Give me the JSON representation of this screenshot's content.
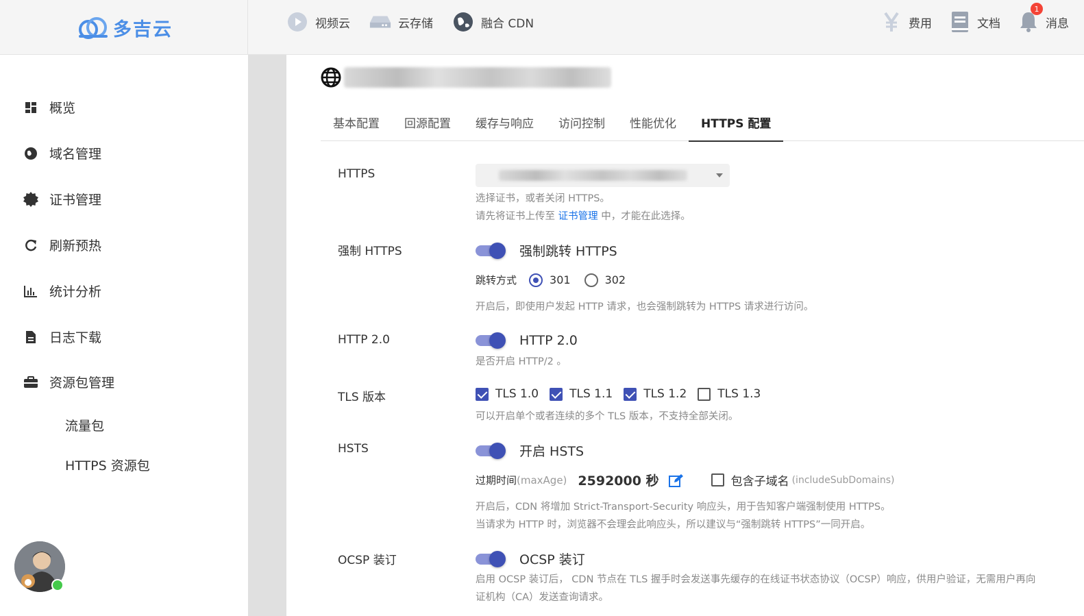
{
  "header": {
    "brand": "多吉云",
    "nav": [
      {
        "label": "视频云",
        "icon": "play-circle-icon"
      },
      {
        "label": "云存储",
        "icon": "storage-drive-icon"
      },
      {
        "label": "融合 CDN",
        "icon": "globe-icon"
      }
    ],
    "right": [
      {
        "label": "费用",
        "icon": "yen-icon"
      },
      {
        "label": "文档",
        "icon": "document-book-icon"
      },
      {
        "label": "消息",
        "icon": "bell-icon",
        "badge": "1"
      }
    ]
  },
  "sidebar": {
    "items": [
      {
        "label": "概览",
        "icon": "dashboard-icon"
      },
      {
        "label": "域名管理",
        "icon": "domain-globe-icon"
      },
      {
        "label": "证书管理",
        "icon": "certificate-seal-icon"
      },
      {
        "label": "刷新预热",
        "icon": "refresh-icon"
      },
      {
        "label": "统计分析",
        "icon": "bar-chart-icon"
      },
      {
        "label": "日志下载",
        "icon": "file-icon"
      },
      {
        "label": "资源包管理",
        "icon": "briefcase-icon"
      }
    ],
    "subitems": [
      "流量包",
      "HTTPS 资源包"
    ]
  },
  "tabs": [
    "基本配置",
    "回源配置",
    "缓存与响应",
    "访问控制",
    "性能优化",
    "HTTPS 配置"
  ],
  "active_tab": "HTTPS 配置",
  "form": {
    "https": {
      "label": "HTTPS",
      "hint1": "选择证书，或者关闭 HTTPS。",
      "hint2_pre": "请先将证书上传至 ",
      "hint2_link": "证书管理",
      "hint2_post": " 中，才能在此选择。"
    },
    "force_https": {
      "label": "强制 HTTPS",
      "switch_label": "强制跳转 HTTPS",
      "enabled": true,
      "redirect_label": "跳转方式",
      "options": [
        "301",
        "302"
      ],
      "selected": "301",
      "hint": "开启后，即使用户发起 HTTP 请求，也会强制跳转为 HTTPS 请求进行访问。"
    },
    "http2": {
      "label": "HTTP 2.0",
      "switch_label": "HTTP 2.0",
      "enabled": true,
      "hint": "是否开启 HTTP/2 。"
    },
    "tls": {
      "label": "TLS 版本",
      "versions": [
        {
          "label": "TLS 1.0",
          "checked": true
        },
        {
          "label": "TLS 1.1",
          "checked": true
        },
        {
          "label": "TLS 1.2",
          "checked": true
        },
        {
          "label": "TLS 1.3",
          "checked": false
        }
      ],
      "hint": "可以开启单个或者连续的多个 TLS 版本，不支持全部关闭。"
    },
    "hsts": {
      "label": "HSTS",
      "switch_label": "开启 HSTS",
      "enabled": true,
      "maxage_label": "过期时间",
      "maxage_key": "(maxAge)",
      "maxage_value": "2592000 秒",
      "subdomains_label": "包含子域名",
      "subdomains_key": "(includeSubDomains)",
      "subdomains_checked": false,
      "hint1": "开启后，CDN 将增加 Strict-Transport-Security 响应头，用于告知客户端强制使用 HTTPS。",
      "hint2": "当请求为 HTTP 时，浏览器不会理会此响应头，所以建议与“强制跳转 HTTPS”一同开启。"
    },
    "ocsp": {
      "label": "OCSP 装订",
      "switch_label": "OCSP 装订",
      "enabled": true,
      "hint1": "启用 OCSP 装订后， CDN 节点在 TLS 握手时会发送事先缓存的在线证书状态协议（OCSP）响应，供用户验证，无需用户再向",
      "hint2": "证机构（CA）发送查询请求。"
    }
  },
  "colors": {
    "accent": "#3f51b5",
    "link": "#1a73e8",
    "brand": "#4b8ee6"
  }
}
